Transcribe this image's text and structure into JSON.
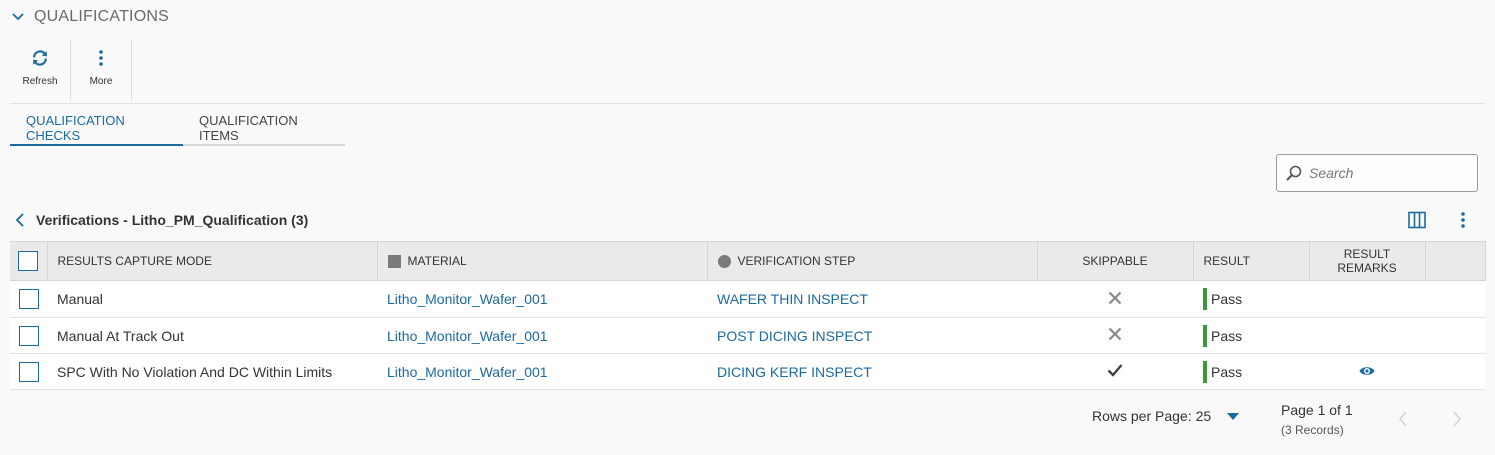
{
  "section": {
    "title": "QUALIFICATIONS"
  },
  "toolbar": {
    "refresh_label": "Refresh",
    "more_label": "More"
  },
  "tabs": [
    {
      "label": "QUALIFICATION CHECKS",
      "active": true
    },
    {
      "label": "QUALIFICATION ITEMS",
      "active": false
    }
  ],
  "search": {
    "placeholder": "Search"
  },
  "list": {
    "title": "Verifications - Litho_PM_Qualification (3)"
  },
  "table": {
    "columns": {
      "mode": "RESULTS CAPTURE MODE",
      "material": "MATERIAL",
      "step": "VERIFICATION STEP",
      "skippable": "SKIPPABLE",
      "result": "RESULT",
      "remarks": "RESULT REMARKS"
    },
    "rows": [
      {
        "mode": "Manual",
        "material": "Litho_Monitor_Wafer_001",
        "step": "WAFER THIN INSPECT",
        "skippable": "no",
        "result": "Pass",
        "remarks_icon": "none"
      },
      {
        "mode": "Manual At Track Out",
        "material": "Litho_Monitor_Wafer_001",
        "step": "POST DICING INSPECT",
        "skippable": "no",
        "result": "Pass",
        "remarks_icon": "none"
      },
      {
        "mode": "SPC With No Violation And DC Within Limits",
        "material": "Litho_Monitor_Wafer_001",
        "step": "DICING KERF INSPECT",
        "skippable": "yes",
        "result": "Pass",
        "remarks_icon": "eye-icon"
      }
    ]
  },
  "pager": {
    "rows_per_page_label": "Rows per Page:",
    "rows_per_page_value": "25",
    "page_label": "Page 1 of 1",
    "records_label": "(3 Records)"
  },
  "colors": {
    "accent": "#1b6aa0",
    "pass": "#3a9a3a",
    "icon_gray": "#8a8a8a"
  }
}
